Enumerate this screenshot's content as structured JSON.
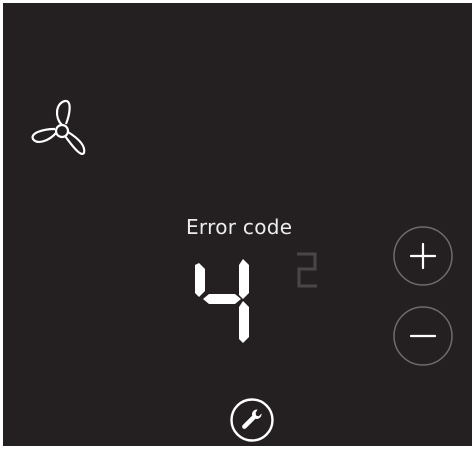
{
  "screen": {
    "error_label": "Error code",
    "error_code_digit": "4",
    "secondary_digit": "2"
  },
  "controls": {
    "fan_icon": "fan-icon",
    "increase_icon": "plus-icon",
    "decrease_icon": "minus-icon",
    "service_icon": "wrench-icon"
  },
  "colors": {
    "background": "#242021",
    "foreground": "#ffffff",
    "dim_digit": "#4a4647",
    "button_ring": "#8a8687"
  }
}
